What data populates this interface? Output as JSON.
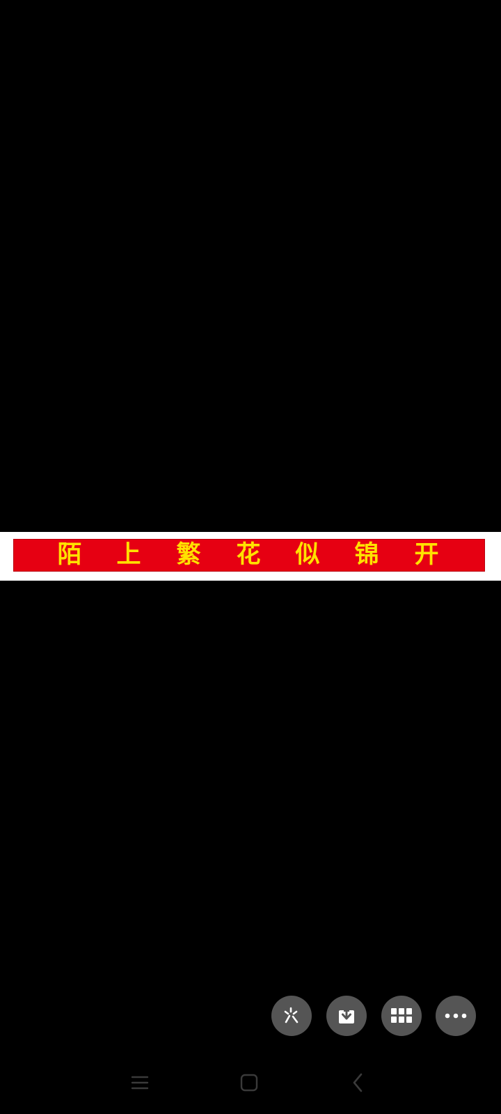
{
  "banner": {
    "chars": [
      "陌",
      "上",
      "繁",
      "花",
      "似",
      "锦",
      "开"
    ],
    "background": "#e60012",
    "text_color": "#ffe100"
  },
  "toolbar": {
    "buttons": [
      {
        "icon": "magic-wand-icon"
      },
      {
        "icon": "download-icon"
      },
      {
        "icon": "grid-icon"
      },
      {
        "icon": "more-icon"
      }
    ],
    "button_color": "#555555"
  },
  "navbar": {
    "buttons": [
      {
        "icon": "menu-icon"
      },
      {
        "icon": "home-icon"
      },
      {
        "icon": "back-icon"
      }
    ]
  }
}
